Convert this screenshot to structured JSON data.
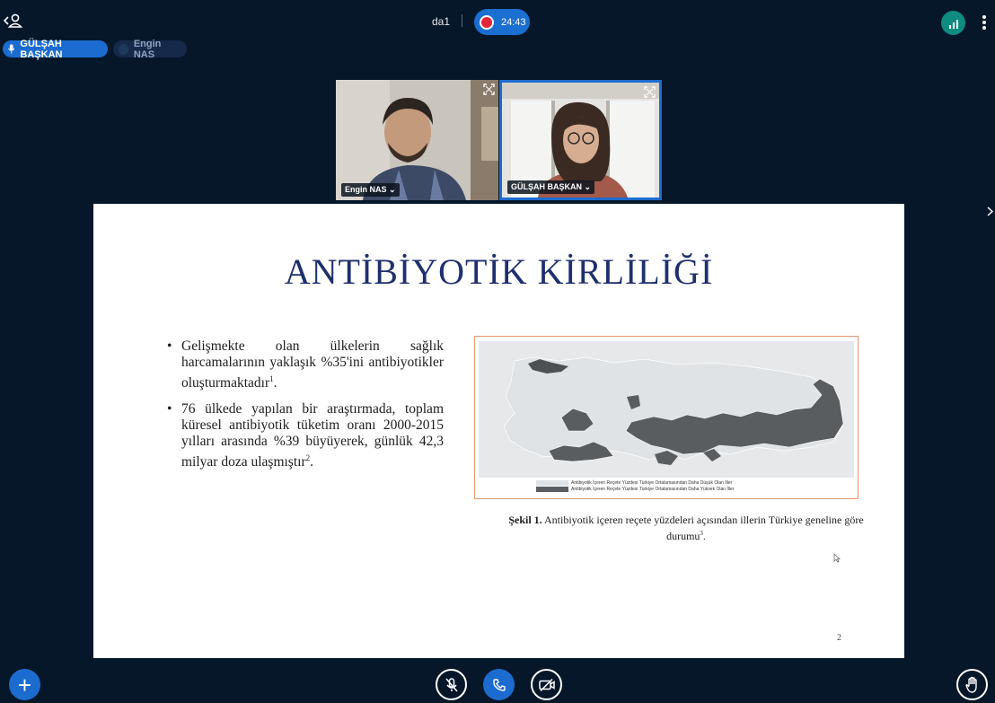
{
  "meeting": {
    "name": "da1",
    "recording_time": "24:43"
  },
  "talkers": [
    {
      "name": "GÜLŞAH BAŞKAN",
      "talking": true
    },
    {
      "name": "Engin NAS",
      "talking": false
    }
  ],
  "videos": [
    {
      "name": "Engin NAS ⌄"
    },
    {
      "name": "GÜLŞAH BAŞKAN ⌄"
    }
  ],
  "slide": {
    "title": "ANTİBİYOTİK KİRLİLİĞİ",
    "bullets": [
      {
        "text": "Gelişmekte olan ülkelerin sağlık harcamalarının yaklaşık %35'ini antibiyotikler oluşturmaktadır",
        "ref": "1",
        "end": "."
      },
      {
        "text": "76 ülkede yapılan bir araştırmada, toplam küresel antibiyotik tüketim oranı 2000-2015 yılları arasında %39 büyüyerek, günlük 42,3 milyar doza ulaşmıştır",
        "ref": "2",
        "end": "."
      }
    ],
    "map_legend": [
      {
        "label": "Antibiyotik İçeren Reçete Yüzdesi Türkiye Ortalamasından Daha Düşük Olan İller",
        "color": "#dfe3e6"
      },
      {
        "label": "Antibiyotik İçeren Reçete Yüzdesi Türkiye Ortalamasından Daha Yüksek Olan İller",
        "color": "#5a5d60"
      }
    ],
    "caption_bold": "Şekil 1.",
    "caption_text": " Antibiyotik içeren reçete yüzdeleri açısından illerin Türkiye geneline göre durumu",
    "caption_ref": "3",
    "caption_end": ".",
    "page_number": "2"
  },
  "controls": {
    "actions_label": "+",
    "mic_icon": "mic-muted-icon",
    "phone_icon": "phone-icon",
    "cam_icon": "camera-off-icon",
    "raise_icon": "raise-hand-icon"
  },
  "colors": {
    "background": "#06172a",
    "accent": "#1c6cd0",
    "title": "#1f2f6e",
    "map_border": "#e8956c",
    "connection": "#0e8c7f",
    "record": "#e3253a"
  }
}
